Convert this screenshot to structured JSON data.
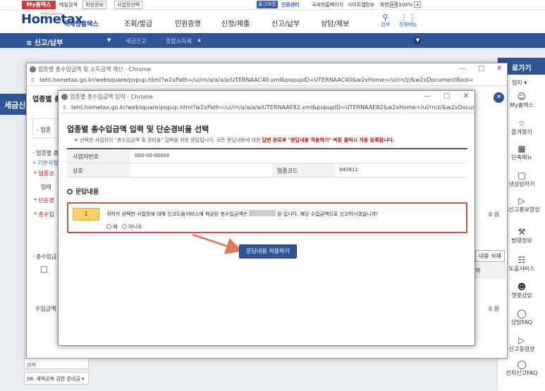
{
  "topbar": {
    "myhome": "My홈택스",
    "mail": "메일검색",
    "member": "회원정보",
    "biz": "사업장선택",
    "logout": "로그아웃",
    "cert": "인증센터",
    "tax_portal": "국세청홈페이지",
    "sitemap": "사이트맵",
    "helpdesk": "정보",
    "screen": "화면크기",
    "zoom_minus": "−",
    "zoom": "100%",
    "zoom_plus": "+"
  },
  "header": {
    "logo": "Hometax",
    "logo_sub": "국세청홈택스",
    "logo_tiny": "안전한 납세서비스",
    "nav": [
      "조회/발급",
      "민원증명",
      "신청/제출",
      "신고/납부",
      "상담/제보"
    ],
    "search": "검색",
    "all_menu": "전체메뉴"
  },
  "breadcrumb": {
    "menu": "≡ 신고/납부",
    "item1": "세금신고",
    "item2": "종합소득세"
  },
  "background": {
    "left_title": "세금신",
    "list_item_1": "선서",
    "list_item_2": "08. 세액공제 감면 준비금 ▾",
    "side_head": "로가기",
    "side_sub": "업지 ▾",
    "side_items": [
      {
        "icon": "person-icon",
        "label": "My홈택스"
      },
      {
        "icon": "star-icon",
        "label": "즐겨찾기"
      },
      {
        "icon": "menu-icon",
        "label": "단축메뉴"
      },
      {
        "icon": "chat-icon",
        "label": "넷상담하기"
      },
      {
        "icon": "play-icon",
        "label": "홈신고홍보영상"
      },
      {
        "icon": "gavel-icon",
        "label": "법령정보"
      },
      {
        "icon": "book-icon",
        "label": "도움서비스"
      },
      {
        "icon": "bot-icon",
        "label": "챗봇상담"
      },
      {
        "icon": "faq-icon",
        "label": "상담FAQ"
      },
      {
        "icon": "video-icon",
        "label": "신고동영상"
      },
      {
        "icon": "faq2-icon",
        "label": "전자신고FAQ"
      }
    ]
  },
  "window1": {
    "title": "업종별 총수입금액 및 소득금액 계산 - Chrome",
    "url": "teht.hometax.go.kr/websquare/popup.html?w2xPath=/ui/rn/a/a/a/a/UTERNAAC40.xml&popupID=UTERNAAC40&w2xHome=/ui/rn/z/&w2xDocumentRoot=",
    "heading": "업종별 총",
    "label_1": "- 업종",
    "label_2": "· 업종별 총",
    "label_3": "• 기본사항",
    "label_4": "* 업종코",
    "label_5": "업태",
    "label_6": "* 단순경",
    "label_7": "* 총수입",
    "label_8": "· 총수입금",
    "label_9": "수입금액",
    "won_1": "0 원",
    "won_2": "0 원",
    "delete_btn": "내용 삭제",
    "col_head": "역"
  },
  "window2": {
    "title": "업종별 총수입금액 입력 - Chrome",
    "url": "teht.hometax.go.kr/websquare/popup.html?w2xPath=/ui/rn/a/a/a/a/UTERNAAE82.xml&popupID=UTERNAAE82&w2xHome=/ui/rn/z/&w2xDocumen...",
    "heading": "업종별 총수입금액 입력 및 단순경비율 선택",
    "notice_pre": "※ 선택한 사업장의 \"총수입금액 및 경비율\" 입력을 위한 문답입니다. 모든 문답내용에 대한 ",
    "notice_red": "답변 완료후 \"문답내용 적용하기\" 버튼 클릭시 자동 등록됩니다.",
    "biz_no_label": "사업자번호",
    "biz_no_value": "000-00-00000",
    "name_label": "상호",
    "name_value": "",
    "code_label": "업종코드",
    "code_value": "940911",
    "section_title": "문답내용",
    "q_num": "1",
    "q_text_pre": "귀하가 선택한 사업장에 대해 신고도움서비스에 제공된 총수입금액은",
    "q_text_post": "원 입니다. 해당 수입금액으로 신고하시겠습니까?",
    "yes": "예",
    "no": "아니오",
    "apply_btn": "문답내용 적용하기"
  },
  "colors": {
    "primary": "#2f5597",
    "myhome_red": "#d9383a",
    "highlight": "#c8553d",
    "q_num_yellow": "#f6d168"
  }
}
